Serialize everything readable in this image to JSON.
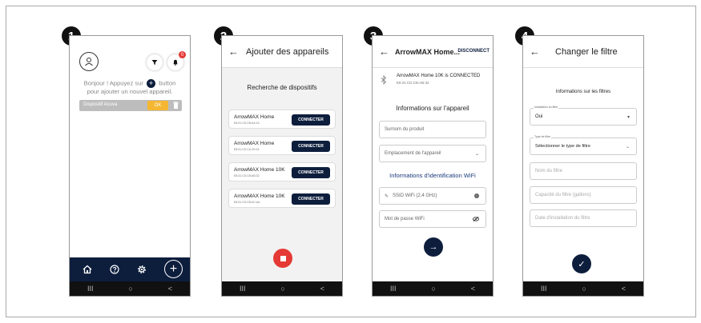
{
  "steps": [
    "1",
    "2",
    "3",
    "4"
  ],
  "screen1": {
    "greeting_line1_a": "Bonjour ! Appuyez sur",
    "greeting_line1_b": "button",
    "greeting_line2": "pour ajouter un nouvel appareil.",
    "device_name": "Dispositif Acuva",
    "ok_label": "OK",
    "badge_count": "0"
  },
  "screen2": {
    "title": "Ajouter des appareils",
    "subtitle": "Recherche de dispositifs",
    "connect_label": "CONNECTER",
    "devices": [
      {
        "name": "ArrowMAX Home",
        "mac": "E8:31:CD:CB:AA:16"
      },
      {
        "name": "ArrowMAX Home",
        "mac": "E8:31:CD:CA:29:C6"
      },
      {
        "name": "ArrowMAX Home 10K",
        "mac": "E8:31:CD:CB:AB:32"
      },
      {
        "name": "ArrowMAX Home 10K",
        "mac": "E8:31:CD:CB:AC:AA"
      }
    ]
  },
  "screen3": {
    "title": "ArrowMAX Home...",
    "disconnect_label": "DISCONNECT",
    "status": "ArrowMAX Home 10K is CONNECTED",
    "status_mac": "E8:31:CD:CB:AB:32",
    "section_info": "Informations sur l'appareil",
    "field_nickname": "Surnom du produit",
    "field_location": "Emplacement de l'appareil",
    "section_wifi": "Informations d'identification WiFi",
    "field_ssid": "SSID WiFi (2,4 GHz)",
    "field_password": "Mot de passe WiFi"
  },
  "screen4": {
    "title": "Changer le filtre",
    "section": "Informations sur les filtres",
    "install_label": "Installation du filtre",
    "install_value": "Oui",
    "type_label": "Type de filtre",
    "type_value": "Sélectionner le type de filtre",
    "field_name": "Nom du filtre",
    "field_capacity": "Capacité du filtre (gallons)",
    "field_date": "Date d'installation du filtre"
  },
  "nav_bar": {
    "recent": "III",
    "home": "○",
    "back": "<"
  },
  "colors": {
    "navy": "#0d1e3d",
    "stop_red": "#e53935",
    "ok_yellow": "#f5b731",
    "badge_red": "#e53935"
  }
}
